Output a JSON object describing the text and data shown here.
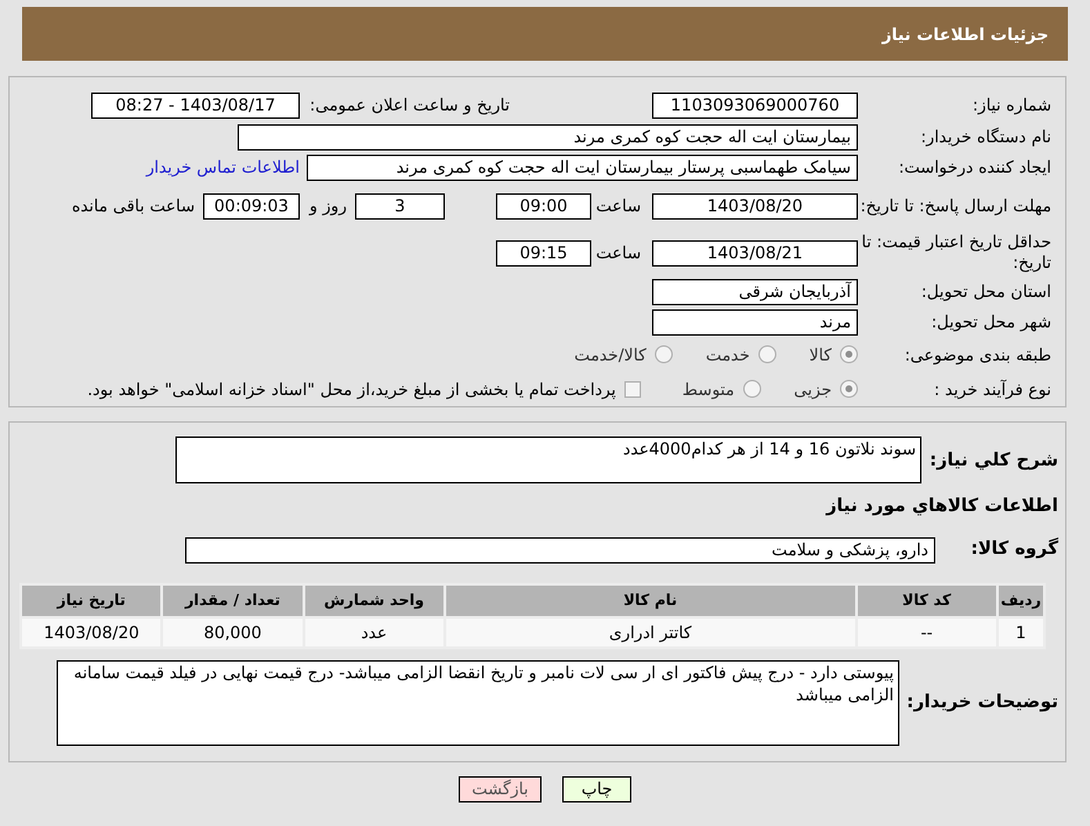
{
  "header": {
    "title": "جزئیات اطلاعات نیاز"
  },
  "fields": {
    "need_number": {
      "label": "شماره نیاز:",
      "value": "1103093069000760"
    },
    "announce": {
      "label": "تاریخ و ساعت اعلان عمومی:",
      "value": "1403/08/17 - 08:27"
    },
    "buyer": {
      "label": "نام دستگاه خریدار:",
      "value": "بیمارستان ایت اله حجت کوه کمری مرند"
    },
    "creator": {
      "label": "ایجاد کننده درخواست:",
      "value": "سیامک طهماسبی پرستار بیمارستان ایت اله حجت کوه کمری مرند",
      "link": "اطلاعات تماس خریدار"
    },
    "deadline": {
      "label": "مهلت ارسال پاسخ: تا تاریخ:",
      "date": "1403/08/20",
      "time_label": "ساعت",
      "time": "09:00",
      "days": "3",
      "days_label": "روز و",
      "remaining": "00:09:03",
      "remaining_label": "ساعت باقی مانده"
    },
    "validity": {
      "label": "حداقل تاریخ اعتبار قیمت: تا تاریخ:",
      "date": "1403/08/21",
      "time_label": "ساعت",
      "time": "09:15"
    },
    "province": {
      "label": "استان محل تحویل:",
      "value": "آذربایجان شرقی"
    },
    "city": {
      "label": "شهر محل تحویل:",
      "value": "مرند"
    },
    "category": {
      "label": "طبقه بندی موضوعی:",
      "options": [
        {
          "label": "کالا",
          "selected": true
        },
        {
          "label": "خدمت",
          "selected": false
        },
        {
          "label": "کالا/خدمت",
          "selected": false
        }
      ]
    },
    "process": {
      "label": "نوع فرآیند خرید :",
      "options": [
        {
          "label": "جزیی",
          "selected": true
        },
        {
          "label": "متوسط",
          "selected": false
        }
      ],
      "checkbox": {
        "label": "پرداخت تمام یا بخشی از مبلغ خرید،از محل \"اسناد خزانه اسلامی\" خواهد بود.",
        "checked": false
      }
    }
  },
  "summary": {
    "label": "شرح کلي نياز:",
    "value": "سوند نلاتون 16 و 14 از هر کدام4000عدد"
  },
  "goods_heading": "اطلاعات كالاهاي مورد نياز",
  "group": {
    "label": "گروه کالا:",
    "value": "دارو، پزشکی و سلامت"
  },
  "table": {
    "columns": [
      "ردیف",
      "کد کالا",
      "نام کالا",
      "واحد شمارش",
      "تعداد / مقدار",
      "تاریخ نیاز"
    ],
    "rows": [
      [
        "1",
        "--",
        "کاتتر ادراری",
        "عدد",
        "80,000",
        "1403/08/20"
      ]
    ]
  },
  "notes": {
    "label": "توضیحات خریدار:",
    "value": "پیوستی دارد - درج پیش فاکتور ای ار سی لات نامبر و تاریخ انقضا الزامی میباشد- درج قیمت نهایی در فیلد قیمت سامانه الزامی میباشد"
  },
  "buttons": [
    {
      "label": "چاپ",
      "kind": "print"
    },
    {
      "label": "بازگشت",
      "kind": "back"
    }
  ]
}
